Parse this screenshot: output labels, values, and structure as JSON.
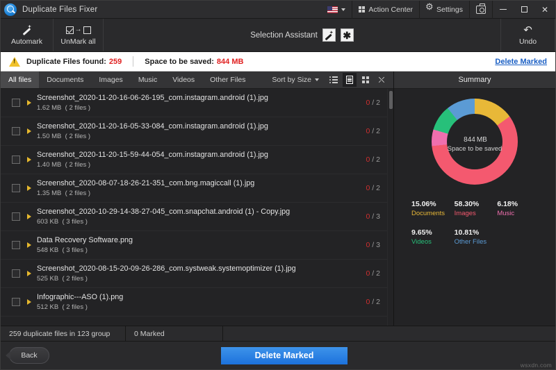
{
  "titlebar": {
    "app_title": "Duplicate Files Fixer",
    "app_icon": "magnifier-disc-icon",
    "language_flag": "us-flag-icon",
    "action_center": "Action Center",
    "settings": "Settings",
    "screenshot_icon": "camera-icon",
    "minimize": "minimize-icon",
    "maximize": "maximize-icon",
    "close": "close-icon"
  },
  "toolbar": {
    "automark": "Automark",
    "unmark_all": "UnMark all",
    "selection_assistant": "Selection Assistant",
    "undo": "Undo"
  },
  "infobar": {
    "found_label": "Duplicate Files found:",
    "found_value": "259",
    "space_label": "Space to be saved:",
    "space_value": "844 MB",
    "delete_marked_link": "Delete Marked"
  },
  "tabs": [
    {
      "label": "All files",
      "active": true
    },
    {
      "label": "Documents",
      "active": false
    },
    {
      "label": "Images",
      "active": false
    },
    {
      "label": "Music",
      "active": false
    },
    {
      "label": "Videos",
      "active": false
    },
    {
      "label": "Other Files",
      "active": false
    }
  ],
  "sort": {
    "label": "Sort by Size"
  },
  "views": [
    {
      "name": "list-view",
      "active": false
    },
    {
      "name": "detail-view",
      "active": true
    },
    {
      "name": "tile-view",
      "active": false
    },
    {
      "name": "fullscreen-view",
      "active": false
    }
  ],
  "files": [
    {
      "name": "Screenshot_2020-11-20-16-06-26-195_com.instagram.android (1).jpg",
      "size": "1.62 MB",
      "files": "( 2 files )",
      "marked": "0",
      "total": "2"
    },
    {
      "name": "Screenshot_2020-11-20-16-05-33-084_com.instagram.android (1).jpg",
      "size": "1.50 MB",
      "files": "( 2 files )",
      "marked": "0",
      "total": "2"
    },
    {
      "name": "Screenshot_2020-11-20-15-59-44-054_com.instagram.android (1).jpg",
      "size": "1.40 MB",
      "files": "( 2 files )",
      "marked": "0",
      "total": "2"
    },
    {
      "name": "Screenshot_2020-08-07-18-26-21-351_com.bng.magiccall (1).jpg",
      "size": "1.35 MB",
      "files": "( 2 files )",
      "marked": "0",
      "total": "2"
    },
    {
      "name": "Screenshot_2020-10-29-14-38-27-045_com.snapchat.android (1) - Copy.jpg",
      "size": "603 KB",
      "files": "( 3 files )",
      "marked": "0",
      "total": "3"
    },
    {
      "name": "Data Recovery Software.png",
      "size": "548 KB",
      "files": "( 3 files )",
      "marked": "0",
      "total": "3"
    },
    {
      "name": "Screenshot_2020-08-15-20-09-26-286_com.systweak.systemoptimizer (1).jpg",
      "size": "525 KB",
      "files": "( 2 files )",
      "marked": "0",
      "total": "2"
    },
    {
      "name": "Infographic---ASO (1).png",
      "size": "512 KB",
      "files": "( 2 files )",
      "marked": "0",
      "total": "2"
    }
  ],
  "summary": {
    "title": "Summary",
    "center_value": "844",
    "center_unit": "MB",
    "center_caption": "Space to be saved"
  },
  "chart_data": {
    "type": "pie",
    "title": "Summary",
    "subtitle": "844 MB Space to be saved",
    "categories": [
      "Documents",
      "Images",
      "Music",
      "Videos",
      "Other Files"
    ],
    "values": [
      15.06,
      58.3,
      6.18,
      9.65,
      10.81
    ],
    "labels": [
      "15.06%",
      "58.30%",
      "6.18%",
      "9.65%",
      "10.81%"
    ],
    "colors": [
      "#e8b838",
      "#f4596f",
      "#ef6fae",
      "#27c07a",
      "#5b9bd5"
    ],
    "unit": "%",
    "hole_ratio": 0.645,
    "start_angle": 0,
    "legend": "bottom-grid"
  },
  "statusbar": {
    "duplicates": "259 duplicate files in 123 group",
    "marked": "0 Marked",
    "extra": ""
  },
  "footer": {
    "back": "Back",
    "delete_marked": "Delete Marked",
    "watermark": "wsxdn.com"
  }
}
